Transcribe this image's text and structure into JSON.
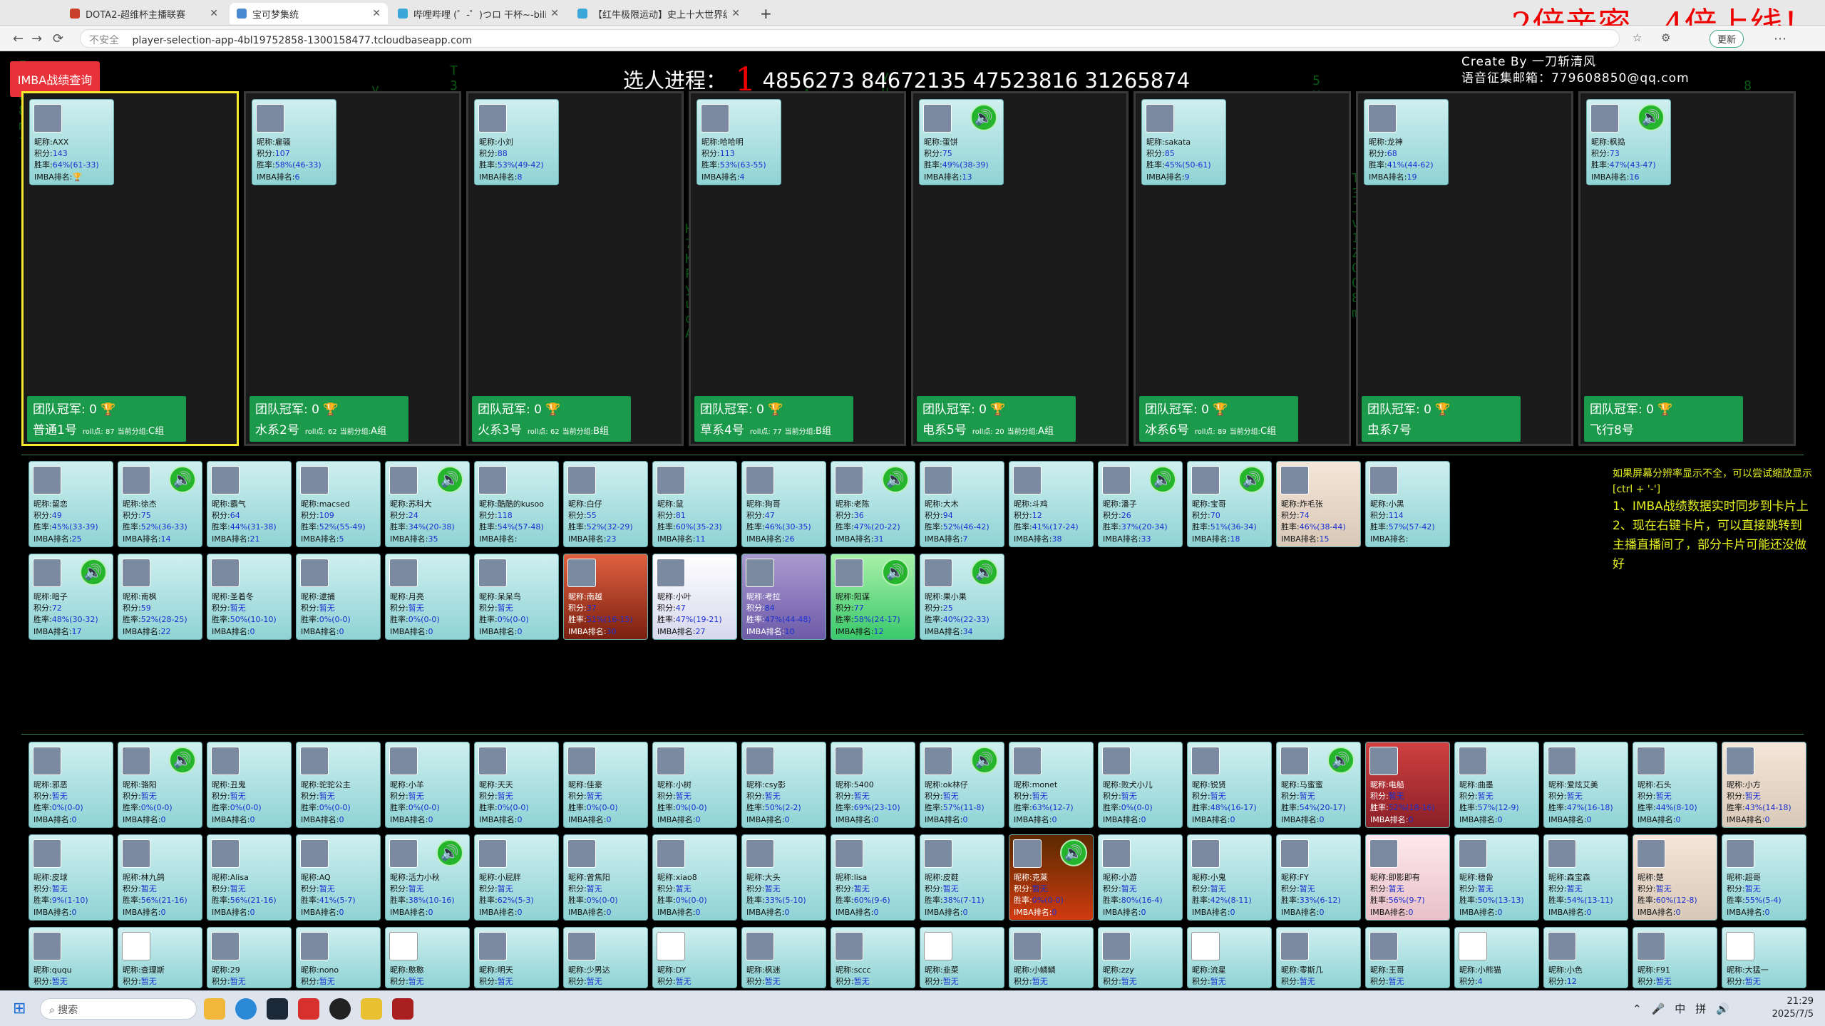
{
  "browser": {
    "tabs": [
      {
        "title": "DOTA2-超维杯主播联赛",
        "color": "#c8402a"
      },
      {
        "title": "宝可梦集统",
        "color": "#4a8ad0",
        "active": true
      },
      {
        "title": "哔哩哔哩 (゜-゜)つロ 干杯~-bilib",
        "color": "#3aa7d8"
      },
      {
        "title": "【红牛极限运动】史上十大世界级",
        "color": "#3aa7d8"
      }
    ],
    "banner": "2倍亲密，4倍上线！",
    "security_label": "不安全",
    "url": "player-selection-app-4bl19752858-1300158477.tcloudbaseapp.com",
    "update_label": "更新"
  },
  "header": {
    "imba_button": "IMBA战绩查询",
    "progress_label": "选人进程：",
    "progress_number": "1",
    "progress_ids": "4856273 84672135 47523816 31265874",
    "credit_line1": "Create By 一刀斩清风",
    "credit_line2": "语音征集邮箱：779608850@qq.com"
  },
  "card_labels": {
    "nick": "昵称:",
    "score": "积分:",
    "rate": "胜率:",
    "rank": "IMBA排名:"
  },
  "teams": [
    {
      "name": "普通1号",
      "champ": "团队冠军: 0 🏆",
      "roll": "roll点: 87",
      "group_label": "当前分组:",
      "group": "C组",
      "captain": {
        "nick": "AXX",
        "score": "143",
        "rate": "64%(61-33)",
        "rank": "🏆",
        "speaker": false
      }
    },
    {
      "name": "水系2号",
      "champ": "团队冠军: 0 🏆",
      "roll": "roll点: 62",
      "group_label": "当前分组:",
      "group": "A组",
      "captain": {
        "nick": "雇骚",
        "score": "107",
        "rate": "58%(46-33)",
        "rank": "6",
        "speaker": false
      }
    },
    {
      "name": "火系3号",
      "champ": "团队冠军: 0 🏆",
      "roll": "roll点: 62",
      "group_label": "当前分组:",
      "group": "B组",
      "captain": {
        "nick": "小刘",
        "score": "88",
        "rate": "53%(49-42)",
        "rank": "8",
        "speaker": false
      }
    },
    {
      "name": "草系4号",
      "champ": "团队冠军: 0 🏆",
      "roll": "roll点: 77",
      "group_label": "当前分组:",
      "group": "B组",
      "captain": {
        "nick": "哈哈明",
        "score": "113",
        "rate": "53%(63-55)",
        "rank": "4",
        "speaker": false
      }
    },
    {
      "name": "电系5号",
      "champ": "团队冠军: 0 🏆",
      "roll": "roll点: 20",
      "group_label": "当前分组:",
      "group": "A组",
      "captain": {
        "nick": "蛋饼",
        "score": "75",
        "rate": "49%(38-39)",
        "rank": "13",
        "speaker": true
      }
    },
    {
      "name": "冰系6号",
      "champ": "团队冠军: 0 🏆",
      "roll": "roll点: 89",
      "group_label": "当前分组:",
      "group": "C组",
      "captain": {
        "nick": "sakata",
        "score": "85",
        "rate": "45%(50-61)",
        "rank": "9",
        "speaker": false
      }
    },
    {
      "name": "虫系7号",
      "champ": "团队冠军: 0 🏆",
      "roll": "",
      "group_label": "",
      "group": "",
      "captain": {
        "nick": "龙神",
        "score": "68",
        "rate": "41%(44-62)",
        "rank": "19",
        "speaker": false
      }
    },
    {
      "name": "飞行8号",
      "champ": "团队冠军: 0 🏆",
      "roll": "",
      "group_label": "",
      "group": "",
      "captain": {
        "nick": "枫捣",
        "score": "73",
        "rate": "47%(43-47)",
        "rank": "16",
        "speaker": true
      }
    }
  ],
  "pool_row1": [
    {
      "nick": "留恋",
      "score": "49",
      "rate": "45%(33-39)",
      "rank": "25",
      "speaker": false,
      "style": ""
    },
    {
      "nick": "徐杰",
      "score": "75",
      "rate": "52%(36-33)",
      "rank": "14",
      "speaker": true,
      "style": ""
    },
    {
      "nick": "霸气",
      "score": "64",
      "rate": "44%(31-38)",
      "rank": "21",
      "speaker": false,
      "style": ""
    },
    {
      "nick": "macsed",
      "score": "109",
      "rate": "52%(55-49)",
      "rank": "5",
      "speaker": false,
      "style": ""
    },
    {
      "nick": "苏科大",
      "score": "24",
      "rate": "34%(20-38)",
      "rank": "35",
      "speaker": true,
      "style": ""
    },
    {
      "nick": "酷酷的kusoo",
      "score": "118",
      "rate": "54%(57-48)",
      "rank": "",
      "speaker": false,
      "style": ""
    },
    {
      "nick": "白仔",
      "score": "55",
      "rate": "52%(32-29)",
      "rank": "23",
      "speaker": false,
      "style": ""
    },
    {
      "nick": "鼠",
      "score": "81",
      "rate": "60%(35-23)",
      "rank": "11",
      "speaker": false,
      "style": ""
    },
    {
      "nick": "狗哥",
      "score": "47",
      "rate": "46%(30-35)",
      "rank": "26",
      "speaker": false,
      "style": ""
    },
    {
      "nick": "老陈",
      "score": "36",
      "rate": "47%(20-22)",
      "rank": "31",
      "speaker": true,
      "style": ""
    },
    {
      "nick": "大木",
      "score": "94",
      "rate": "52%(46-42)",
      "rank": "7",
      "speaker": false,
      "style": ""
    },
    {
      "nick": "斗鸡",
      "score": "12",
      "rate": "41%(17-24)",
      "rank": "38",
      "speaker": false,
      "style": ""
    },
    {
      "nick": "潘子",
      "score": "26",
      "rate": "37%(20-34)",
      "rank": "33",
      "speaker": true,
      "style": ""
    },
    {
      "nick": "宝哥",
      "score": "70",
      "rate": "51%(36-34)",
      "rank": "18",
      "speaker": true,
      "style": ""
    },
    {
      "nick": "炸毛张",
      "score": "74",
      "rate": "46%(38-44)",
      "rank": "15",
      "speaker": false,
      "style": "cream"
    },
    {
      "nick": "小黑",
      "score": "114",
      "rate": "57%(57-42)",
      "rank": "",
      "speaker": false,
      "style": ""
    }
  ],
  "pool_row2": [
    {
      "nick": "暗子",
      "score": "72",
      "rate": "48%(30-32)",
      "rank": "17",
      "speaker": true,
      "style": ""
    },
    {
      "nick": "南枫",
      "score": "59",
      "rate": "52%(28-25)",
      "rank": "22",
      "speaker": false,
      "style": ""
    },
    {
      "nick": "圣着冬",
      "score": "暂无",
      "rate": "50%(10-10)",
      "rank": "0",
      "speaker": false,
      "style": ""
    },
    {
      "nick": "逮捕",
      "score": "暂无",
      "rate": "0%(0-0)",
      "rank": "0",
      "speaker": false,
      "style": ""
    },
    {
      "nick": "月亮",
      "score": "暂无",
      "rate": "0%(0-0)",
      "rank": "0",
      "speaker": false,
      "style": ""
    },
    {
      "nick": "呆呆鸟",
      "score": "暂无",
      "rate": "0%(0-0)",
      "rank": "0",
      "speaker": false,
      "style": ""
    },
    {
      "nick": "南越",
      "score": "37",
      "rate": "51%(16-15)",
      "rank": "30",
      "speaker": false,
      "style": "dark"
    },
    {
      "nick": "小叶",
      "score": "47",
      "rate": "47%(19-21)",
      "rank": "27",
      "speaker": false,
      "style": "white"
    },
    {
      "nick": "考拉",
      "score": "84",
      "rate": "47%(44-48)",
      "rank": "10",
      "speaker": false,
      "style": "violet"
    },
    {
      "nick": "阳谋",
      "score": "77",
      "rate": "58%(24-17)",
      "rank": "12",
      "speaker": true,
      "style": "green"
    },
    {
      "nick": "果小果",
      "score": "25",
      "rate": "40%(22-33)",
      "rank": "34",
      "speaker": true,
      "style": ""
    }
  ],
  "lower_row1": [
    {
      "nick": "邪恶",
      "score": "暂无",
      "rate": "0%(0-0)",
      "rank": "0",
      "speaker": false,
      "style": ""
    },
    {
      "nick": "骆阳",
      "score": "暂无",
      "rate": "0%(0-0)",
      "rank": "0",
      "speaker": true,
      "style": ""
    },
    {
      "nick": "丑鬼",
      "score": "暂无",
      "rate": "0%(0-0)",
      "rank": "0",
      "speaker": false,
      "style": ""
    },
    {
      "nick": "驼驼公主",
      "score": "暂无",
      "rate": "0%(0-0)",
      "rank": "0",
      "speaker": false,
      "style": ""
    },
    {
      "nick": "小羊",
      "score": "暂无",
      "rate": "0%(0-0)",
      "rank": "0",
      "speaker": false,
      "style": ""
    },
    {
      "nick": "天天",
      "score": "暂无",
      "rate": "0%(0-0)",
      "rank": "0",
      "speaker": false,
      "style": ""
    },
    {
      "nick": "佳豪",
      "score": "暂无",
      "rate": "0%(0-0)",
      "rank": "0",
      "speaker": false,
      "style": ""
    },
    {
      "nick": "小树",
      "score": "暂无",
      "rate": "0%(0-0)",
      "rank": "0",
      "speaker": false,
      "style": ""
    },
    {
      "nick": "csy影",
      "score": "暂无",
      "rate": "50%(2-2)",
      "rank": "0",
      "speaker": false,
      "style": ""
    },
    {
      "nick": "5400",
      "score": "暂无",
      "rate": "69%(23-10)",
      "rank": "0",
      "speaker": false,
      "style": ""
    },
    {
      "nick": "ok林仔",
      "score": "暂无",
      "rate": "57%(11-8)",
      "rank": "0",
      "speaker": true,
      "style": ""
    },
    {
      "nick": "monet",
      "score": "暂无",
      "rate": "63%(12-7)",
      "rank": "0",
      "speaker": false,
      "style": ""
    },
    {
      "nick": "败犬小儿",
      "score": "暂无",
      "rate": "0%(0-0)",
      "rank": "0",
      "speaker": false,
      "style": ""
    },
    {
      "nick": "锐贤",
      "score": "暂无",
      "rate": "48%(16-17)",
      "rank": "0",
      "speaker": false,
      "style": ""
    },
    {
      "nick": "马蜜蜜",
      "score": "暂无",
      "rate": "54%(20-17)",
      "rank": "0",
      "speaker": true,
      "style": ""
    },
    {
      "nick": "电船",
      "score": "暂无",
      "rate": "52%(18-16)",
      "rank": "0",
      "speaker": false,
      "style": "maroon"
    },
    {
      "nick": "曲墨",
      "score": "暂无",
      "rate": "57%(12-9)",
      "rank": "0",
      "speaker": false,
      "style": ""
    },
    {
      "nick": "爱炫艾美",
      "score": "暂无",
      "rate": "47%(16-18)",
      "rank": "0",
      "speaker": false,
      "style": ""
    },
    {
      "nick": "石头",
      "score": "暂无",
      "rate": "44%(8-10)",
      "rank": "0",
      "speaker": false,
      "style": ""
    },
    {
      "nick": "小方",
      "score": "暂无",
      "rate": "43%(14-18)",
      "rank": "0",
      "speaker": false,
      "style": "cream"
    }
  ],
  "lower_row2": [
    {
      "nick": "皮球",
      "score": "暂无",
      "rate": "9%(1-10)",
      "rank": "0",
      "speaker": false,
      "style": ""
    },
    {
      "nick": "林九鸽",
      "score": "暂无",
      "rate": "56%(21-16)",
      "rank": "0",
      "speaker": false,
      "style": ""
    },
    {
      "nick": "Alisa",
      "score": "暂无",
      "rate": "56%(21-16)",
      "rank": "0",
      "speaker": false,
      "style": ""
    },
    {
      "nick": "AQ",
      "score": "暂无",
      "rate": "41%(5-7)",
      "rank": "0",
      "speaker": false,
      "style": ""
    },
    {
      "nick": "活力小秋",
      "score": "暂无",
      "rate": "38%(10-16)",
      "rank": "0",
      "speaker": true,
      "style": ""
    },
    {
      "nick": "小屁胖",
      "score": "暂无",
      "rate": "62%(5-3)",
      "rank": "0",
      "speaker": false,
      "style": ""
    },
    {
      "nick": "曾焦阳",
      "score": "暂无",
      "rate": "0%(0-0)",
      "rank": "0",
      "speaker": false,
      "style": ""
    },
    {
      "nick": "xiao8",
      "score": "暂无",
      "rate": "0%(0-0)",
      "rank": "0",
      "speaker": false,
      "style": ""
    },
    {
      "nick": "大头",
      "score": "暂无",
      "rate": "33%(5-10)",
      "rank": "0",
      "speaker": false,
      "style": ""
    },
    {
      "nick": "lisa",
      "score": "暂无",
      "rate": "60%(9-6)",
      "rank": "0",
      "speaker": false,
      "style": ""
    },
    {
      "nick": "皮鞋",
      "score": "暂无",
      "rate": "38%(7-11)",
      "rank": "0",
      "speaker": false,
      "style": ""
    },
    {
      "nick": "克莱",
      "score": "暂无",
      "rate": "0%(0-0)",
      "rank": "0",
      "speaker": true,
      "style": "fire"
    },
    {
      "nick": "小游",
      "score": "暂无",
      "rate": "80%(16-4)",
      "rank": "0",
      "speaker": false,
      "style": ""
    },
    {
      "nick": "小鬼",
      "score": "暂无",
      "rate": "42%(8-11)",
      "rank": "0",
      "speaker": false,
      "style": ""
    },
    {
      "nick": "FY",
      "score": "暂无",
      "rate": "33%(6-12)",
      "rank": "0",
      "speaker": false,
      "style": ""
    },
    {
      "nick": "即影即有",
      "score": "暂无",
      "rate": "56%(9-7)",
      "rank": "0",
      "speaker": false,
      "style": "pink"
    },
    {
      "nick": "穗骨",
      "score": "暂无",
      "rate": "50%(13-13)",
      "rank": "0",
      "speaker": false,
      "style": ""
    },
    {
      "nick": "森宝森",
      "score": "暂无",
      "rate": "54%(13-11)",
      "rank": "0",
      "speaker": false,
      "style": ""
    },
    {
      "nick": "楚",
      "score": "暂无",
      "rate": "60%(12-8)",
      "rank": "0",
      "speaker": false,
      "style": "cream"
    },
    {
      "nick": "超哥",
      "score": "暂无",
      "rate": "55%(5-4)",
      "rank": "0",
      "speaker": false,
      "style": ""
    }
  ],
  "lower_row3": [
    {
      "nick": "ququ",
      "score": "暂无",
      "speaker": false
    },
    {
      "nick": "查理斯",
      "score": "暂无",
      "speaker": false
    },
    {
      "nick": "29",
      "score": "暂无",
      "speaker": false
    },
    {
      "nick": "nono",
      "score": "暂无",
      "speaker": false
    },
    {
      "nick": "憨憨",
      "score": "暂无",
      "speaker": false
    },
    {
      "nick": "明天",
      "score": "暂无",
      "speaker": false
    },
    {
      "nick": "少男达",
      "score": "暂无",
      "speaker": false
    },
    {
      "nick": "DY",
      "score": "暂无",
      "speaker": false
    },
    {
      "nick": "枫迷",
      "score": "暂无",
      "speaker": false
    },
    {
      "nick": "sccc",
      "score": "暂无",
      "speaker": false
    },
    {
      "nick": "韭菜",
      "score": "暂无",
      "speaker": false
    },
    {
      "nick": "小鳞鳞",
      "score": "暂无",
      "speaker": false
    },
    {
      "nick": "zzy",
      "score": "暂无",
      "speaker": false
    },
    {
      "nick": "流星",
      "score": "暂无",
      "speaker": false
    },
    {
      "nick": "零斯几",
      "score": "暂无",
      "speaker": false
    },
    {
      "nick": "王哥",
      "score": "暂无",
      "speaker": false
    },
    {
      "nick": "小熊猫",
      "score": "4",
      "speaker": false
    },
    {
      "nick": "小色",
      "score": "12",
      "speaker": false
    },
    {
      "nick": "F91",
      "score": "暂无",
      "speaker": false
    },
    {
      "nick": "大猛一",
      "score": "暂无",
      "speaker": false
    }
  ],
  "notes": {
    "line1": "如果屏幕分辨率显示不全，可以尝试缩放显示[ctrl + '-']",
    "line2": "1、IMBA战绩数据实时同步到卡片上",
    "line3": "2、现在右键卡片，可以直接跳转到主播直播间了，部分卡片可能还没做好"
  },
  "taskbar": {
    "search_placeholder": "搜索",
    "ime1": "中",
    "ime2": "拼",
    "time": "21:29",
    "date": "2025/7/5"
  }
}
